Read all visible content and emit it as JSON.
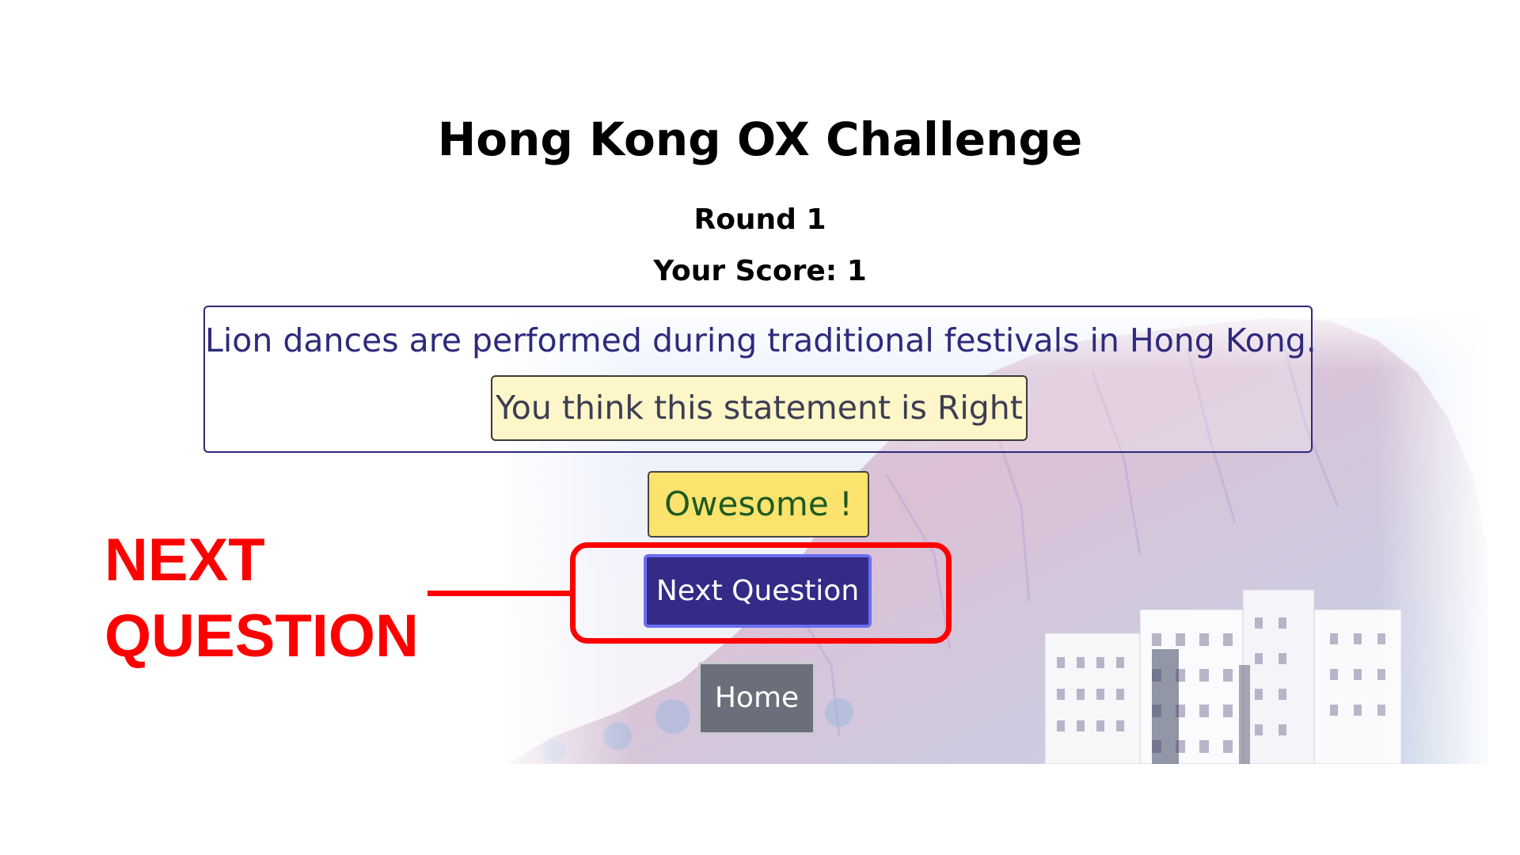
{
  "game": {
    "title": "Hong Kong OX Challenge",
    "round_label": "Round 1",
    "score_label": "Your Score: 1"
  },
  "question": {
    "statement": "Lion dances are performed during traditional festivals in Hong Kong.",
    "user_answer": "You think this statement is Right"
  },
  "feedback": {
    "message": "Owesome !"
  },
  "buttons": {
    "next": "Next Question",
    "home": "Home"
  },
  "annotation": {
    "label": "NEXT\nQUESTION"
  },
  "colors": {
    "title": "#000000",
    "statement_text": "#2e2a7c",
    "card_border": "#2d2a7a",
    "answer_bg": "#fdf6c8",
    "feedback_bg": "#fbe36e",
    "feedback_text": "#1e5a21",
    "next_bg": "#332b86",
    "next_border": "#6b6ef0",
    "home_bg": "#6b6f7b",
    "annotation_red": "#ff0000"
  }
}
